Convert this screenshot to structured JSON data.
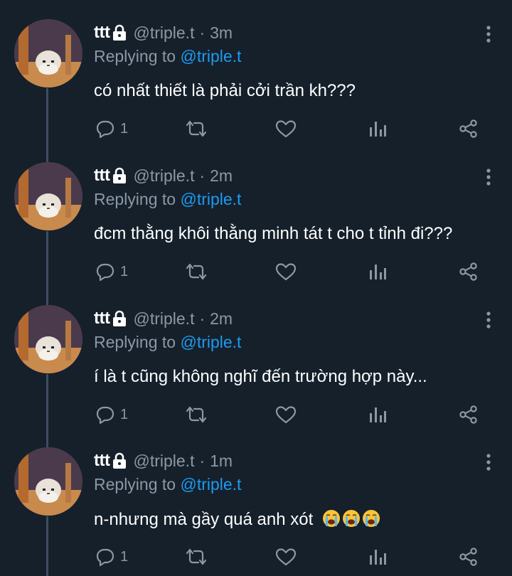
{
  "tweets": [
    {
      "name": "ttt",
      "handle": "@triple.t",
      "dot": "·",
      "time": "3m",
      "replying_prefix": "Replying to ",
      "replying_to": "@triple.t",
      "text": "có nhất thiết là phải cởi trần kh???",
      "reply_count": "1",
      "emojis": []
    },
    {
      "name": "ttt",
      "handle": "@triple.t",
      "dot": "·",
      "time": "2m",
      "replying_prefix": "Replying to ",
      "replying_to": "@triple.t",
      "text": "đcm thằng khôi thằng minh tát t cho t tỉnh đi???",
      "reply_count": "1",
      "emojis": []
    },
    {
      "name": "ttt",
      "handle": "@triple.t",
      "dot": "·",
      "time": "2m",
      "replying_prefix": "Replying to ",
      "replying_to": "@triple.t",
      "text": "í là t cũng không nghĩ đến trường hợp này...",
      "reply_count": "1",
      "emojis": []
    },
    {
      "name": "ttt",
      "handle": "@triple.t",
      "dot": "·",
      "time": "1m",
      "replying_prefix": "Replying to ",
      "replying_to": "@triple.t",
      "text": "n-nhưng mà gầy quá anh xót",
      "reply_count": "1",
      "emojis": [
        "loudly-crying-face",
        "loudly-crying-face",
        "loudly-crying-face"
      ]
    }
  ],
  "icons": {
    "lock": "lock-icon",
    "more": "more-vertical-icon",
    "reply": "reply-icon",
    "retweet": "retweet-icon",
    "like": "heart-icon",
    "views": "analytics-icon",
    "share": "share-icon"
  },
  "colors": {
    "background": "#15202b",
    "text": "#ffffff",
    "secondary": "#8b98a5",
    "mention": "#1d9bf0",
    "thread_line": "#3d4e5f"
  }
}
